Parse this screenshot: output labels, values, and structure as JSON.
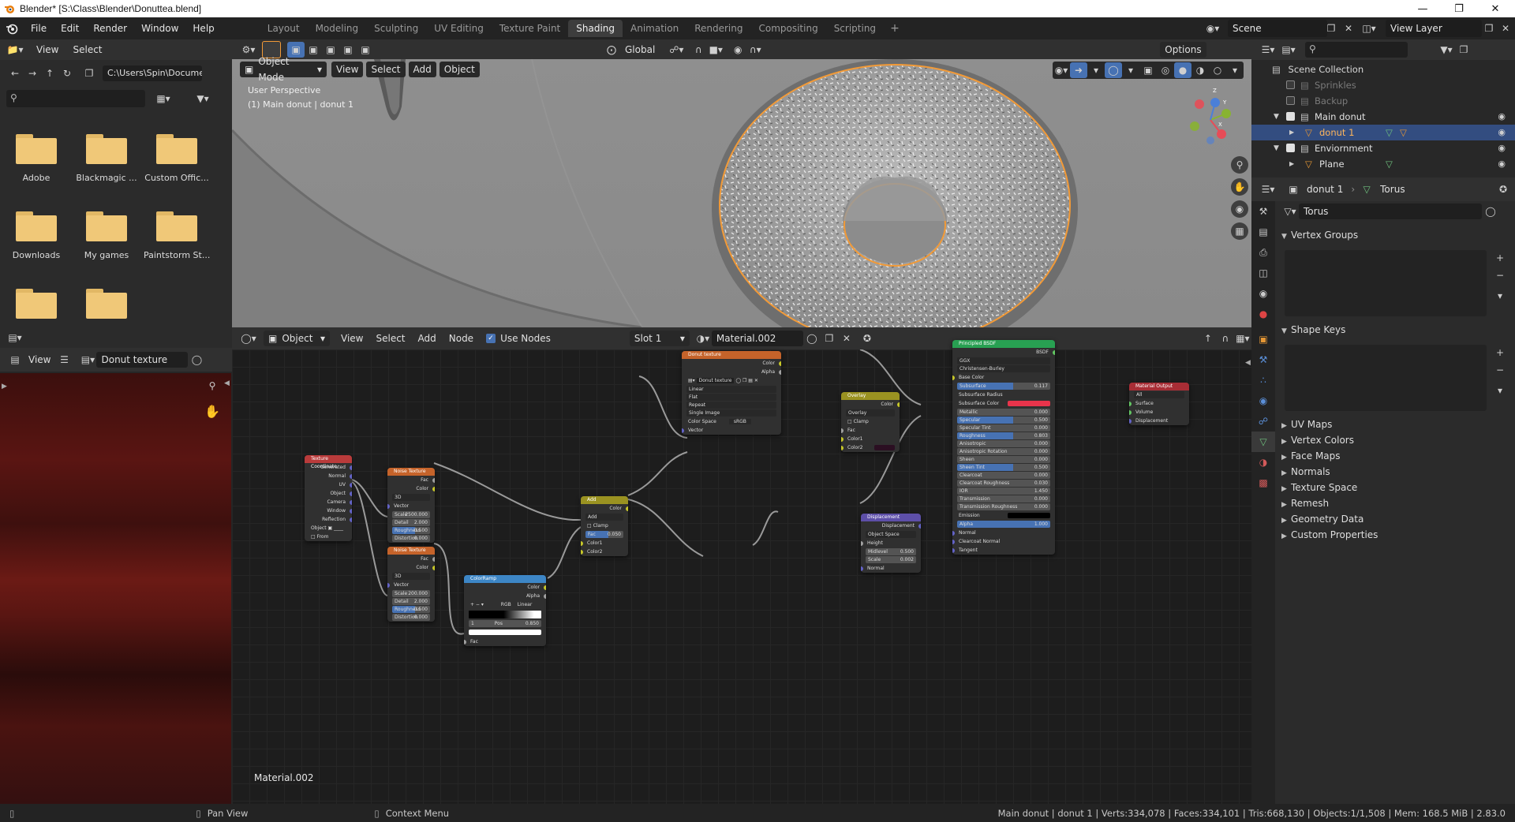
{
  "window": {
    "title": "Blender* [S:\\Class\\Blender\\Donuttea.blend]"
  },
  "menu": [
    "File",
    "Edit",
    "Render",
    "Window",
    "Help"
  ],
  "workspaces": [
    {
      "label": "Layout",
      "active": false
    },
    {
      "label": "Modeling",
      "active": false
    },
    {
      "label": "Sculpting",
      "active": false
    },
    {
      "label": "UV Editing",
      "active": false
    },
    {
      "label": "Texture Paint",
      "active": false
    },
    {
      "label": "Shading",
      "active": true
    },
    {
      "label": "Animation",
      "active": false
    },
    {
      "label": "Rendering",
      "active": false
    },
    {
      "label": "Compositing",
      "active": false
    },
    {
      "label": "Scripting",
      "active": false
    }
  ],
  "scene": {
    "name": "Scene",
    "view_layer": "View Layer"
  },
  "file_browser": {
    "header": {
      "view": "View",
      "select": "Select"
    },
    "path": "C:\\Users\\Spin\\Docume...",
    "folders": [
      "Adobe",
      "Blackmagic ...",
      "Custom Offic...",
      "Downloads",
      "My games",
      "Paintstorm St...",
      "",
      ""
    ]
  },
  "image_editor": {
    "view": "View",
    "image_name": "Donut texture"
  },
  "viewport": {
    "mode": "Object Mode",
    "menus": [
      "View",
      "Select",
      "Add",
      "Object"
    ],
    "orientation": "Global",
    "options": "Options",
    "perspective_label": "User Perspective",
    "object_label": "(1) Main donut | donut 1",
    "gizmo": {
      "x": "X",
      "y": "Y",
      "z": "Z"
    }
  },
  "node_editor": {
    "type": "Object",
    "menus": [
      "View",
      "Select",
      "Add",
      "Node"
    ],
    "use_nodes": "Use Nodes",
    "slot": "Slot 1",
    "material": "Material.002",
    "material_label": "Material.002",
    "nodes": {
      "texcoord": {
        "title": "Texture Coordinate",
        "outputs": [
          "Generated",
          "Normal",
          "UV",
          "Object",
          "Camera",
          "Window",
          "Reflection"
        ],
        "object": "Object",
        "from_instancer": "From Instancer"
      },
      "noise1": {
        "title": "Noise Texture",
        "outputs": [
          "Fac",
          "Color"
        ],
        "dim": "3D",
        "vector": "Vector",
        "scale": {
          "label": "Scale",
          "value": "2500.000"
        },
        "detail": {
          "label": "Detail",
          "value": "2.000"
        },
        "roughness": {
          "label": "Roughness",
          "value": "0.500"
        },
        "distortion": {
          "label": "Distortion",
          "value": "0.000"
        }
      },
      "noise2": {
        "title": "Noise Texture",
        "outputs": [
          "Fac",
          "Color"
        ],
        "dim": "3D",
        "vector": "Vector",
        "scale": {
          "label": "Scale",
          "value": "200.000"
        },
        "detail": {
          "label": "Detail",
          "value": "2.000"
        },
        "roughness": {
          "label": "Roughness",
          "value": "0.500"
        },
        "distortion": {
          "label": "Distortion",
          "value": "0.000"
        }
      },
      "colorramp": {
        "title": "ColorRamp",
        "outputs": [
          "Color",
          "Alpha"
        ],
        "mode": "RGB",
        "interp": "Linear",
        "index": "1",
        "pos_label": "Pos",
        "pos": "0.850",
        "fac": "Fac"
      },
      "add": {
        "title": "Add",
        "output": "Color",
        "blend": "Add",
        "clamp": "Clamp",
        "fac": {
          "label": "Fac",
          "value": "0.050"
        },
        "color1": "Color1",
        "color2": "Color2"
      },
      "donut_texture": {
        "title": "Donut texture",
        "outputs": [
          "Color",
          "Alpha"
        ],
        "image": "Donut texture",
        "interp": "Linear",
        "proj": "Flat",
        "ext": "Repeat",
        "source": "Single Image",
        "colorspace_label": "Color Space",
        "colorspace": "sRGB",
        "vector": "Vector"
      },
      "overlay": {
        "title": "Overlay",
        "output": "Color",
        "blend": "Overlay",
        "clamp": "Clamp",
        "fac": "Fac",
        "color1": "Color1",
        "color2": "Color2"
      },
      "displacement": {
        "title": "Displacement",
        "output": "Displacement",
        "space": "Object Space",
        "height": "Height",
        "midlevel": {
          "label": "Midlevel",
          "value": "0.500"
        },
        "scale": {
          "label": "Scale",
          "value": "0.002"
        },
        "normal": "Normal"
      },
      "principled": {
        "title": "Principled BSDF",
        "output": "BSDF",
        "dist": "GGX",
        "sss_method": "Christensen-Burley",
        "rows": [
          {
            "label": "Base Color",
            "value": "",
            "kind": "socket"
          },
          {
            "label": "Subsurface",
            "value": "0.117",
            "kind": "blue"
          },
          {
            "label": "Subsurface Radius",
            "value": "",
            "kind": "drop"
          },
          {
            "label": "Subsurface Color",
            "value": "",
            "kind": "color"
          },
          {
            "label": "Metallic",
            "value": "0.000",
            "kind": "field"
          },
          {
            "label": "Specular",
            "value": "0.500",
            "kind": "blue"
          },
          {
            "label": "Specular Tint",
            "value": "0.000",
            "kind": "field"
          },
          {
            "label": "Roughness",
            "value": "0.803",
            "kind": "blue"
          },
          {
            "label": "Anisotropic",
            "value": "0.000",
            "kind": "field"
          },
          {
            "label": "Anisotropic Rotation",
            "value": "0.000",
            "kind": "field"
          },
          {
            "label": "Sheen",
            "value": "0.000",
            "kind": "field"
          },
          {
            "label": "Sheen Tint",
            "value": "0.500",
            "kind": "blue"
          },
          {
            "label": "Clearcoat",
            "value": "0.000",
            "kind": "field"
          },
          {
            "label": "Clearcoat Roughness",
            "value": "0.030",
            "kind": "field"
          },
          {
            "label": "IOR",
            "value": "1.450",
            "kind": "field"
          },
          {
            "label": "Transmission",
            "value": "0.000",
            "kind": "field"
          },
          {
            "label": "Transmission Roughness",
            "value": "0.000",
            "kind": "field"
          },
          {
            "label": "Emission",
            "value": "",
            "kind": "black"
          },
          {
            "label": "Alpha",
            "value": "1.000",
            "kind": "bluefull"
          },
          {
            "label": "Normal",
            "value": "",
            "kind": "socket"
          },
          {
            "label": "Clearcoat Normal",
            "value": "",
            "kind": "socket"
          },
          {
            "label": "Tangent",
            "value": "",
            "kind": "socket"
          }
        ]
      },
      "output": {
        "title": "Material Output",
        "target": "All",
        "inputs": [
          "Surface",
          "Volume",
          "Displacement"
        ]
      }
    }
  },
  "outliner": {
    "root": "Scene Collection",
    "rows": [
      {
        "label": "Sprinkles",
        "indent": 1,
        "checked": false,
        "dim": true,
        "selected": false,
        "eye": false
      },
      {
        "label": "Backup",
        "indent": 1,
        "checked": false,
        "dim": true,
        "selected": false,
        "eye": false
      },
      {
        "label": "Main donut",
        "indent": 1,
        "checked": true,
        "dim": false,
        "selected": false,
        "eye": true
      },
      {
        "label": "donut 1",
        "indent": 2,
        "checked": null,
        "dim": false,
        "selected": true,
        "eye": true
      },
      {
        "label": "Enviornment",
        "indent": 1,
        "checked": true,
        "dim": false,
        "selected": false,
        "eye": true
      },
      {
        "label": "Plane",
        "indent": 2,
        "checked": null,
        "dim": false,
        "selected": false,
        "eye": true
      }
    ]
  },
  "properties": {
    "object": "donut 1",
    "mesh": "Torus",
    "mesh_field": "Torus",
    "sections_open": [
      "Vertex Groups",
      "Shape Keys"
    ],
    "sections_closed": [
      "UV Maps",
      "Vertex Colors",
      "Face Maps",
      "Normals",
      "Texture Space",
      "Remesh",
      "Geometry Data",
      "Custom Properties"
    ]
  },
  "statusbar": {
    "left1": "Pan View",
    "left2": "Context Menu",
    "right": "Main donut | donut 1 | Verts:334,078 | Faces:334,101 | Tris:668,130 | Objects:1/1,508 | Mem: 168.5 MiB | 2.83.0"
  },
  "colors": {
    "accent": "#4772b3",
    "selection": "#334d80",
    "active_workspace": "#3d3d3d",
    "node_texture": "#c5632a",
    "node_input": "#b93b3b",
    "node_color": "#9a9221",
    "node_converter": "#3d86c6",
    "node_shader": "#28a052",
    "node_vector": "#5d4fa8",
    "node_output": "#a82d35",
    "orange_outline": "#f29a37"
  }
}
